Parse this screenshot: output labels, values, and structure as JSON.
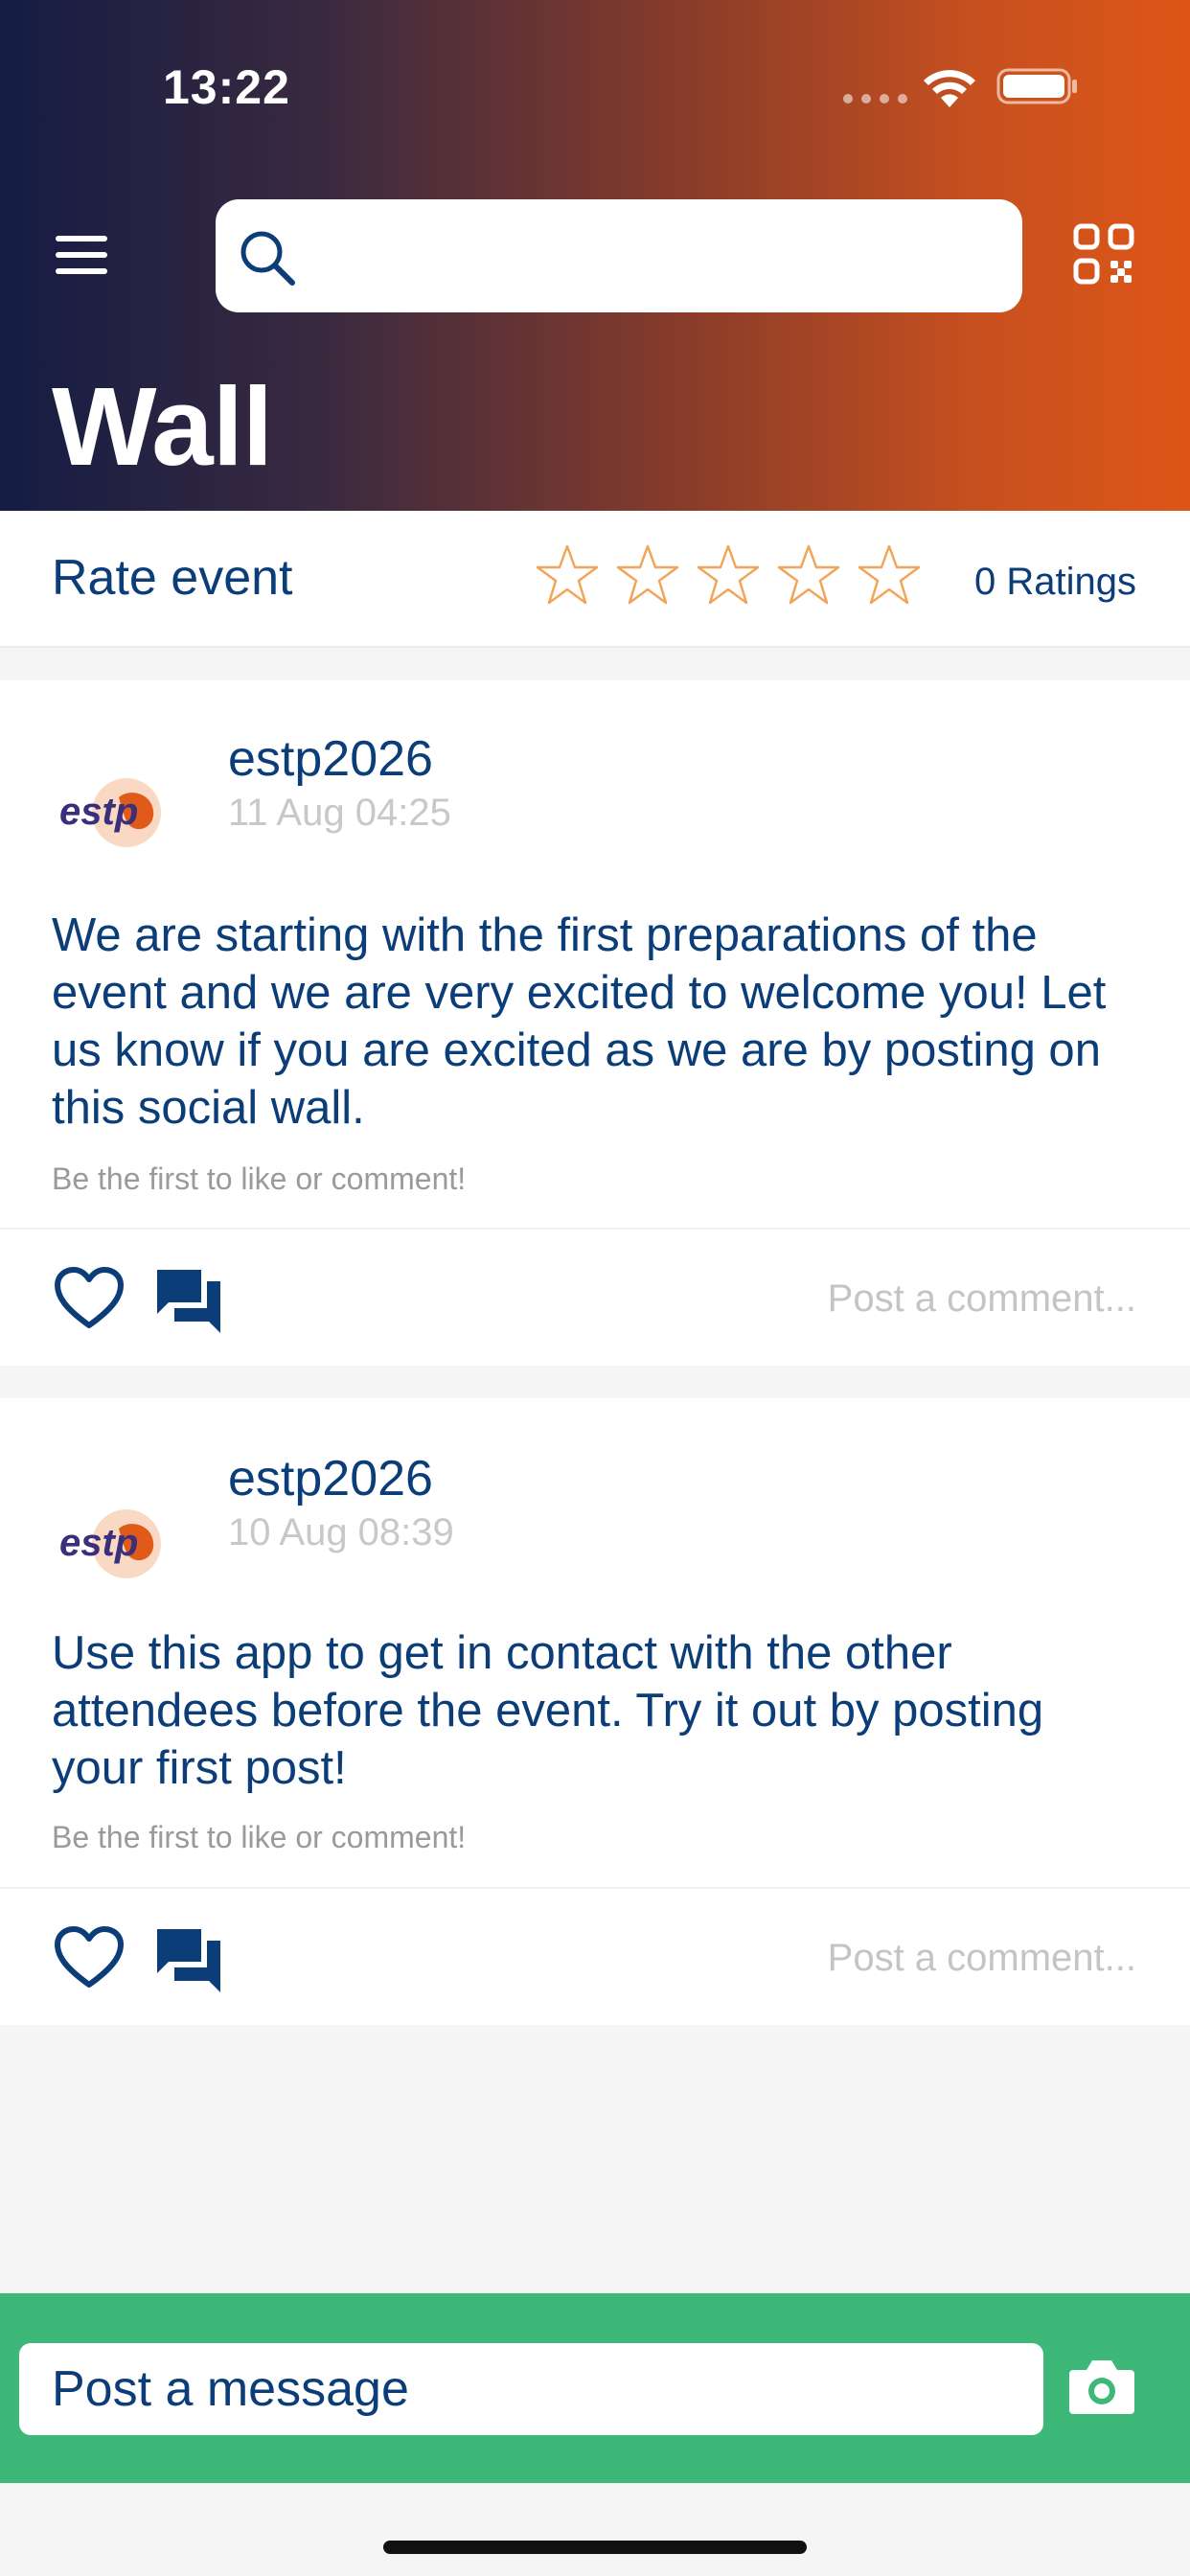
{
  "status_bar": {
    "time": "13:22"
  },
  "header": {
    "title": "Wall",
    "search": {
      "placeholder": "",
      "value": ""
    },
    "icons": [
      "menu-icon",
      "search-icon",
      "qr-code-icon"
    ]
  },
  "rating": {
    "label": "Rate event",
    "stars_total": 5,
    "stars_filled": 0,
    "count_label": "0 Ratings",
    "star_color": "#f2a55a"
  },
  "posts": [
    {
      "author": "estp2026",
      "time": "11 Aug 04:25",
      "body": "We are starting with the first preparations of the event and we are very excited to welcome you! Let us know if you are excited as we are by posting on this social wall.",
      "hint": "Be the first to like or comment!",
      "comment_placeholder": "Post a comment..."
    },
    {
      "author": "estp2026",
      "time": "10 Aug 08:39",
      "body": "Use this app to get in contact with the other attendees before the event. Try it out by posting your first post!",
      "hint": "Be the first to like or comment!",
      "comment_placeholder": "Post a comment..."
    }
  ],
  "avatar_logo": {
    "text": "estp"
  },
  "compose": {
    "placeholder": "Post a message",
    "bar_color": "#3eb879",
    "icon": "camera-icon"
  },
  "colors": {
    "primary_text": "#0b3d78",
    "gradient_start": "#141c44",
    "gradient_end": "#de5617",
    "accent_green": "#3eb879"
  }
}
